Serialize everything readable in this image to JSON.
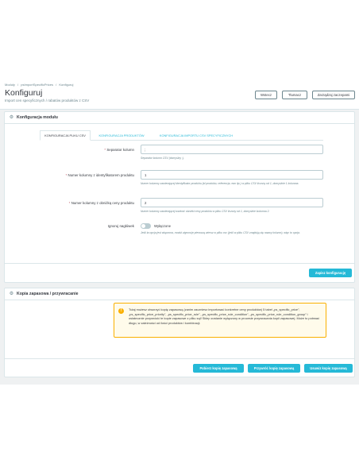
{
  "breadcrumb": [
    "Moduły",
    "/",
    "psImportSpecificPrices",
    "/",
    "Konfiguruj"
  ],
  "page": {
    "title": "Konfiguruj",
    "subtitle": "Import cen specyficznych / rabatów produktów z CSV"
  },
  "header_buttons": {
    "back": "Wstecz",
    "translate": "Tłumacz",
    "hooks": "Zarządzaj zaczepami"
  },
  "config_panel": {
    "title": "Konfiguracja modułu",
    "tabs": [
      "KONFIGURACJA PLIKU CSV",
      "KONFIGURACJA PRODUKTÓW",
      "KONFIGURACJA IMPORTU CSV SPECYFICZNYCH"
    ],
    "fields": {
      "separator": {
        "label": "Separator kolumn",
        "value": ";",
        "help": "Separator kolumn CSV (domyślny ;)."
      },
      "id_column": {
        "label": "Numer kolumny z identyfikatorem produktu",
        "value": "1",
        "help": "Numer kolumny zawierającej identyfikator produktu (id produktu, referencja, ean itp.) w pliku CSV liczony od 1, domyślnie 1 kolumna."
      },
      "price_column": {
        "label": "Numer kolumny z obniżką ceny produktu",
        "value": "2",
        "help": "Numer kolumny zawierającej wartość obniżki ceny produktu w pliku CSV liczony od 1, domyślnie kolumna 2."
      },
      "ignore_header": {
        "label": "Ignoruj nagłówek",
        "value": "Wyłączone",
        "help": "Jeśli ta opcja jest włączona, moduł zignoruje pierwszą wiersz w pliku csv (jeśli w pliku CSV znajdują się nazwy kolumn), więc to opcja."
      }
    },
    "save_button": "Zapisz konfigurację"
  },
  "backup_panel": {
    "title": "Kopia zapasowa / przywracanie",
    "alert": "Tutaj możesz utworzyć kopię zapasową (zanim zaczniesz importować konkretne ceny produktów) 5 tabel „ps_specific_price”, „ps_specific_price_priority”, „ps_specific_price_rule”, „ps_specific_price_rule_condition”, „ps_specific_price_rule_condition_group” i ostatecznie przywrócić te kopie zapasowe z pliku sql! Sklep zostanie wyłączony w procesie przywracania kopii zapasowej. Może to potrwać długo, w zależności od ilości produktów i kombinacji.",
    "buttons": {
      "download": "Pobierz kopię zapasową",
      "restore": "Przywróć kopię zapasową",
      "delete": "Usuwiz kopię zapasową"
    }
  },
  "colors": {
    "primary": "#25b9d7",
    "background": "#eff1f2",
    "warning_border": "#fab000",
    "warning_bg": "#fffbeb"
  }
}
